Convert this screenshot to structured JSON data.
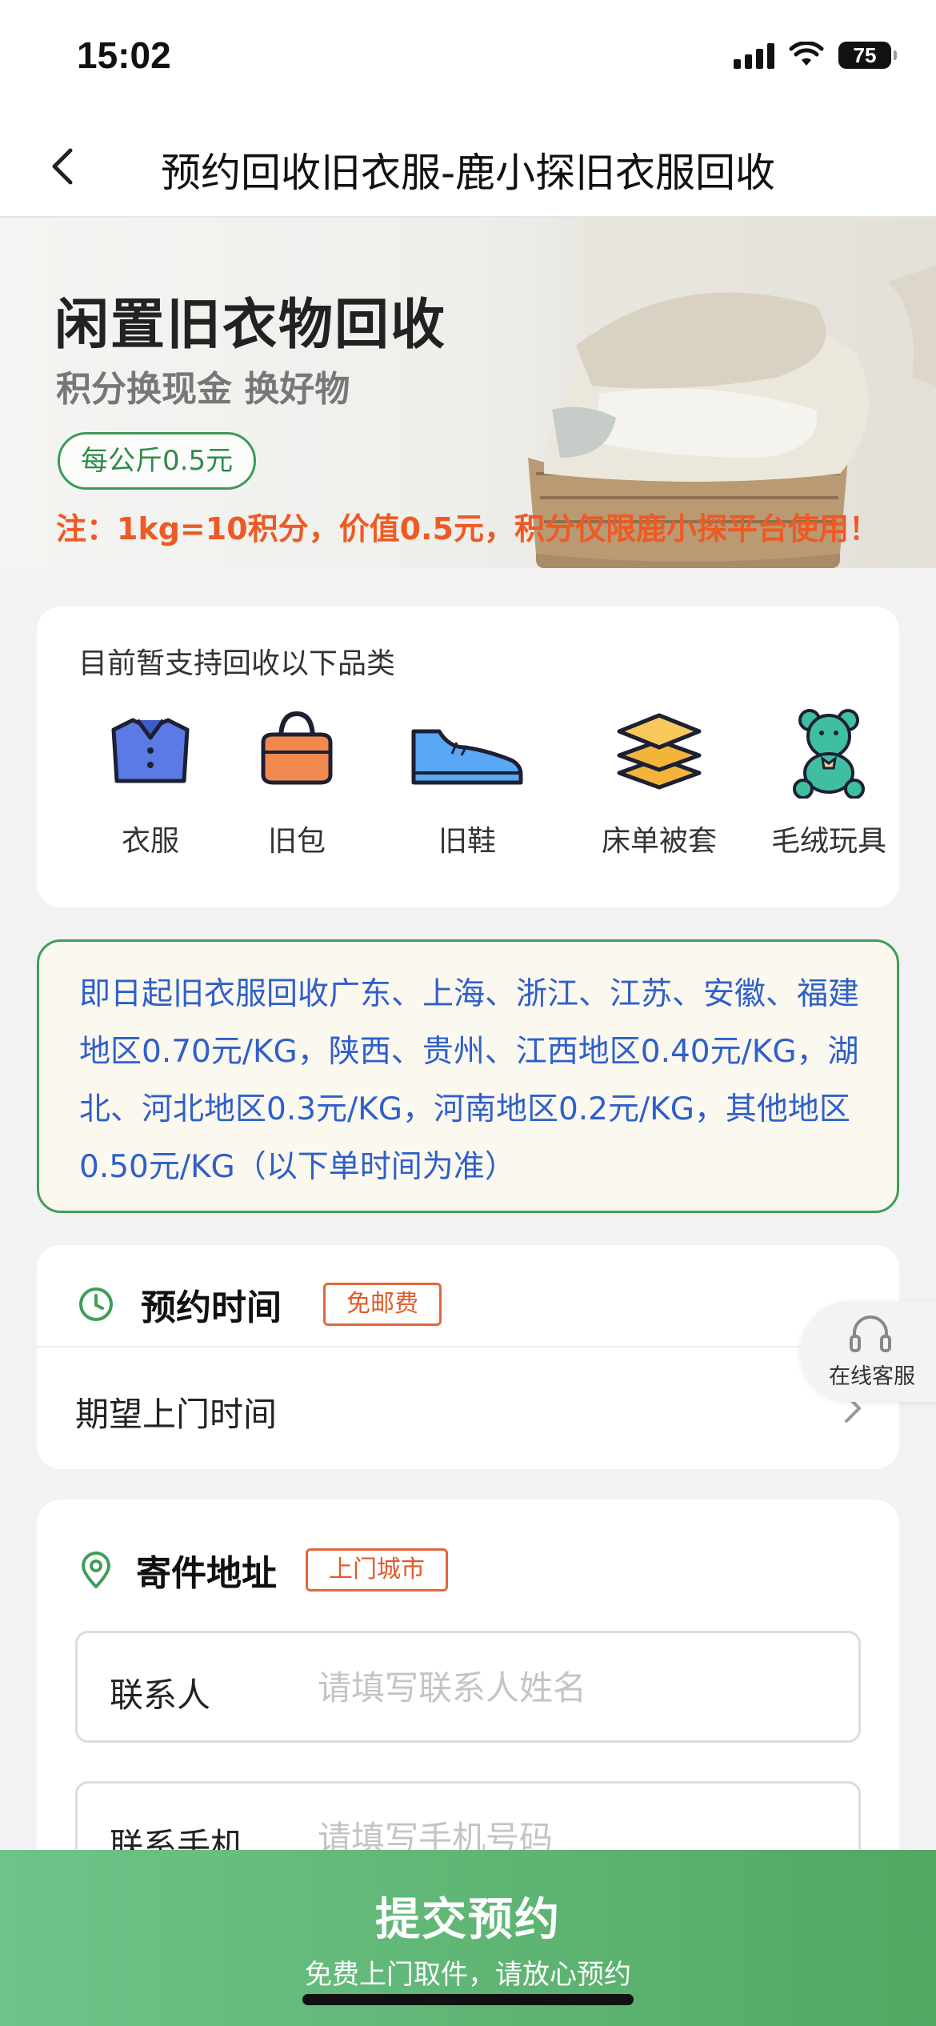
{
  "status_bar": {
    "time": "15:02",
    "battery": "75"
  },
  "nav": {
    "title": "预约回收旧衣服-鹿小探旧衣服回收",
    "back_icon": "chevron-left-icon"
  },
  "banner": {
    "title": "闲置旧衣物回收",
    "subtitle": "积分换现金 换好物",
    "price_badge": "每公斤0.5元",
    "note": "注：1kg=10积分，价值0.5元，积分仅限鹿小探平台使用！"
  },
  "categories": {
    "heading": "目前暂支持回收以下品类",
    "items": [
      {
        "label": "衣服",
        "icon": "shirt-icon"
      },
      {
        "label": "旧包",
        "icon": "handbag-icon"
      },
      {
        "label": "旧鞋",
        "icon": "shoe-icon"
      },
      {
        "label": "床单被套",
        "icon": "bedding-icon"
      },
      {
        "label": "毛绒玩具",
        "icon": "teddy-bear-icon"
      }
    ]
  },
  "notice": {
    "text": "即日起旧衣服回收广东、上海、浙江、江苏、安徽、福建地区0.70元/KG，陕西、贵州、江西地区0.40元/KG，湖北、河北地区0.3元/KG，河南地区0.2元/KG，其他地区0.50元/KG（以下单时间为准）"
  },
  "appointment": {
    "title": "预约时间",
    "tag": "免邮费",
    "icon": "clock-icon",
    "time_label": "期望上门时间"
  },
  "address": {
    "title": "寄件地址",
    "tag": "上门城市",
    "icon": "location-pin-icon",
    "contact_label": "联系人",
    "contact_placeholder": "请填写联系人姓名",
    "phone_label": "联系手机",
    "phone_placeholder": "请填写手机号码"
  },
  "service": {
    "label": "在线客服",
    "icon": "headset-icon"
  },
  "submit": {
    "title": "提交预约",
    "subtitle": "免费上门取件，请放心预约"
  },
  "colors": {
    "accent_green": "#3f9e58",
    "notice_blue": "#2f5fc9",
    "warning_orange": "#ee5a24"
  }
}
